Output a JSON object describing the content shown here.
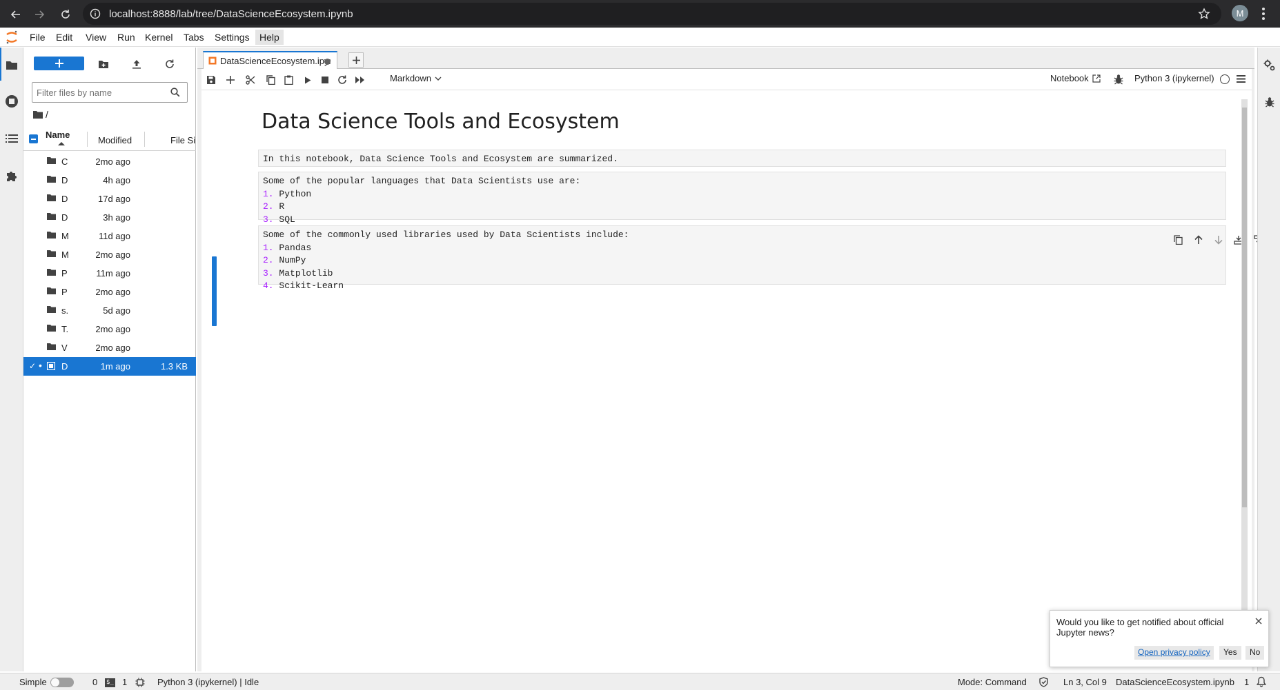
{
  "browser": {
    "url": "localhost:8888/lab/tree/DataScienceEcosystem.ipynb",
    "profile_initial": "M"
  },
  "menubar": {
    "items": [
      "File",
      "Edit",
      "View",
      "Run",
      "Kernel",
      "Tabs",
      "Settings",
      "Help"
    ]
  },
  "filebrowser": {
    "filter_placeholder": "Filter files by name",
    "breadcrumb": "/",
    "columns": {
      "name": "Name",
      "modified": "Modified",
      "size": "File Si"
    },
    "files": [
      {
        "name": "C",
        "modified": "2mo ago",
        "size": "",
        "type": "folder"
      },
      {
        "name": "D",
        "modified": "4h ago",
        "size": "",
        "type": "folder"
      },
      {
        "name": "D",
        "modified": "17d ago",
        "size": "",
        "type": "folder"
      },
      {
        "name": "D",
        "modified": "3h ago",
        "size": "",
        "type": "folder"
      },
      {
        "name": "M",
        "modified": "11d ago",
        "size": "",
        "type": "folder"
      },
      {
        "name": "M",
        "modified": "2mo ago",
        "size": "",
        "type": "folder"
      },
      {
        "name": "P",
        "modified": "11m ago",
        "size": "",
        "type": "folder"
      },
      {
        "name": "P",
        "modified": "2mo ago",
        "size": "",
        "type": "folder"
      },
      {
        "name": "s.",
        "modified": "5d ago",
        "size": "",
        "type": "folder"
      },
      {
        "name": "T.",
        "modified": "2mo ago",
        "size": "",
        "type": "folder"
      },
      {
        "name": "V",
        "modified": "2mo ago",
        "size": "",
        "type": "folder"
      },
      {
        "name": "D",
        "modified": "1m ago",
        "size": "1.3 KB",
        "type": "notebook",
        "selected": true
      }
    ]
  },
  "tab": {
    "label": "DataScienceEcosystem.ipynb",
    "dirty": true
  },
  "toolbar": {
    "cell_type": "Markdown",
    "notebook_link": "Notebook",
    "kernel": "Python 3 (ipykernel)"
  },
  "notebook": {
    "title": "Data Science Tools and Ecosystem",
    "cell1": "In this notebook, Data Science Tools and Ecosystem are summarized.",
    "cell2": {
      "intro": "Some of the popular languages that Data Scientists use are:",
      "items": [
        {
          "num": "1.",
          "text": "Python"
        },
        {
          "num": "2.",
          "text": "R"
        },
        {
          "num": "3.",
          "text": "SQL"
        }
      ]
    },
    "cell3": {
      "intro": "Some of the commonly used libraries used by Data Scientists include:",
      "items": [
        {
          "num": "1.",
          "text": "Pandas"
        },
        {
          "num": "2.",
          "text": "NumPy"
        },
        {
          "num": "3.",
          "text": "Matplotlib"
        },
        {
          "num": "4.",
          "text": "Scikit-Learn"
        }
      ]
    }
  },
  "notification": {
    "message": "Would you like to get notified about official Jupyter news?",
    "policy_link": "Open privacy policy",
    "yes": "Yes",
    "no": "No"
  },
  "statusbar": {
    "mode_label": "Simple",
    "terminals": "0",
    "kernels": "1",
    "kernel_status": "Python 3 (ipykernel) | Idle",
    "mode": "Mode: Command",
    "cursor": "Ln 3, Col 9",
    "filename": "DataScienceEcosystem.ipynb",
    "notifications": "1"
  },
  "colors": {
    "accent": "#1976d2",
    "list_number": "#aa22ff",
    "chrome_bg": "#2b2b2d",
    "jupyter_orange": "#f37726"
  }
}
